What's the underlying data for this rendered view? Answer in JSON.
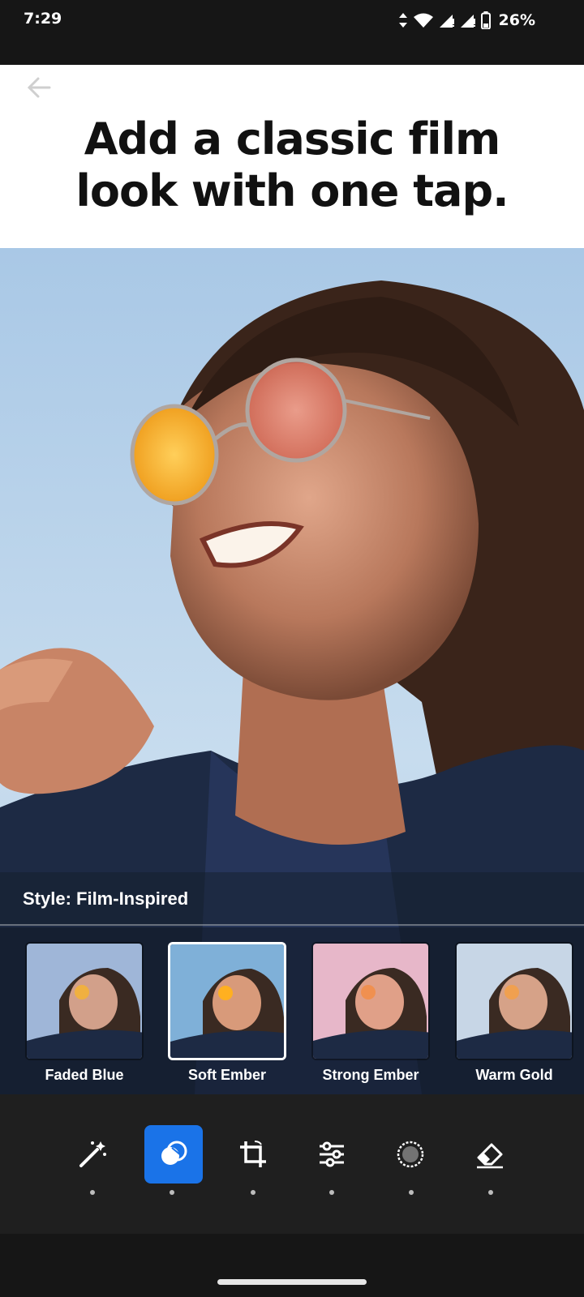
{
  "status": {
    "time": "7:29",
    "battery": "26%"
  },
  "header": {
    "headline_line1": "Add a classic film",
    "headline_line2": "look with one tap."
  },
  "style": {
    "label": "Style: Film-Inspired"
  },
  "presets": [
    {
      "name": "Faded Blue",
      "tint": "#9fb6d8",
      "selected": false
    },
    {
      "name": "Soft Ember",
      "tint": "#7fb0d8",
      "selected": true
    },
    {
      "name": "Strong Ember",
      "tint": "#e7b7c9",
      "selected": false
    },
    {
      "name": "Warm Gold",
      "tint": "#c7d6e6",
      "selected": false
    }
  ],
  "toolbar": {
    "tools": [
      "magic-wand-icon",
      "looks-icon",
      "crop-icon",
      "adjust-sliders-icon",
      "vignette-icon",
      "eraser-icon"
    ],
    "active_index": 1,
    "accent": "#1a73e8"
  }
}
